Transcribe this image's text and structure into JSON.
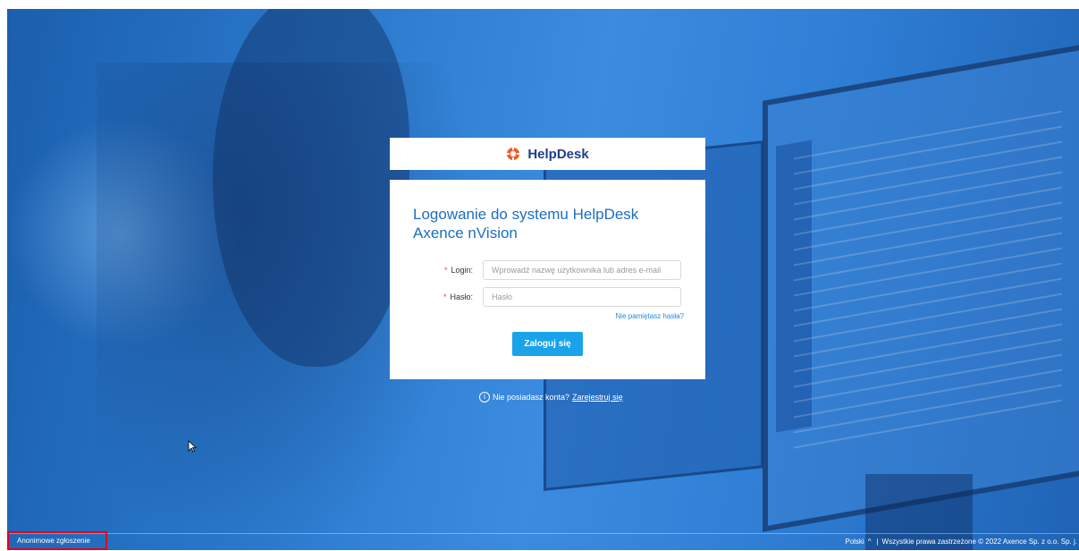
{
  "brand": {
    "name": "HelpDesk",
    "logo_icon": "lifebuoy-icon",
    "accent": "#f05a28"
  },
  "login": {
    "title_line1": "Logowanie do systemu HelpDesk",
    "title_line2": "Axence nVision",
    "login_label": "Login:",
    "login_placeholder": "Wprowadź nazwę użytkownika lub adres e-mail",
    "login_value": "",
    "password_label": "Hasło:",
    "password_placeholder": "Hasło",
    "password_value": "",
    "required_mark": "*",
    "forgot_link": "Nie pamiętasz hasła?",
    "submit_label": "Zaloguj się",
    "button_color": "#1aa3e8",
    "title_color": "#1b6fbf"
  },
  "register": {
    "info_icon": "info-icon",
    "info_glyph": "i",
    "prompt": "Nie posiadasz konta?",
    "link": "Zarejestruj się"
  },
  "footer": {
    "anonymous_report": "Anonimowe zgłoszenie",
    "language": "Polski",
    "language_chevron": "^",
    "separator": "|",
    "copyright": "Wszystkie prawa zastrzeżone © 2022 Axence Sp. z o.o. Sp. j."
  }
}
